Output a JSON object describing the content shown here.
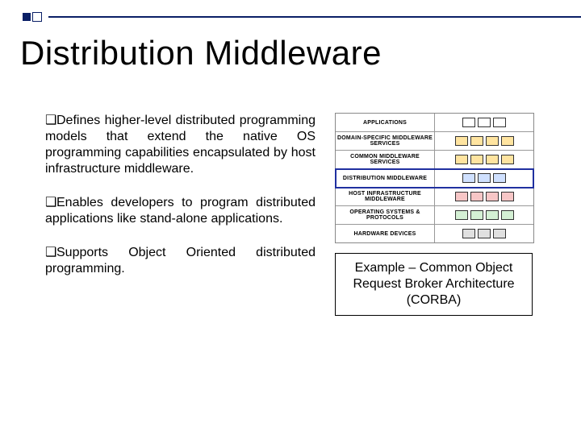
{
  "title": "Distribution Middleware",
  "bullet_glyph": "❑",
  "paragraphs": [
    "Defines higher-level distributed programming models that extend the native OS programming capabilities encapsulated by host infrastructure middleware.",
    "Enables developers to program distributed applications like stand-alone applications.",
    "Supports Object Oriented distributed programming."
  ],
  "diagram": {
    "layers": [
      {
        "label": "APPLICATIONS",
        "highlight": false,
        "icons": [
          "app",
          "app",
          "app"
        ]
      },
      {
        "label": "DOMAIN-SPECIFIC MIDDLEWARE SERVICES",
        "highlight": false,
        "icons": [
          "svc",
          "svc",
          "svc",
          "svc"
        ]
      },
      {
        "label": "COMMON MIDDLEWARE SERVICES",
        "highlight": false,
        "icons": [
          "svc",
          "svc",
          "svc",
          "svc"
        ]
      },
      {
        "label": "DISTRIBUTION MIDDLEWARE",
        "highlight": true,
        "icons": [
          "stk",
          "stk",
          "stk"
        ]
      },
      {
        "label": "HOST INFRASTRUCTURE MIDDLEWARE",
        "highlight": false,
        "icons": [
          "bar",
          "bar",
          "bar",
          "bar"
        ]
      },
      {
        "label": "OPERATING SYSTEMS & PROTOCOLS",
        "highlight": false,
        "icons": [
          "os",
          "os",
          "os",
          "os"
        ]
      },
      {
        "label": "HARDWARE DEVICES",
        "highlight": false,
        "icons": [
          "hw",
          "hw",
          "hw"
        ]
      }
    ]
  },
  "caption": "Example – Common Object Request Broker Architecture (CORBA)"
}
